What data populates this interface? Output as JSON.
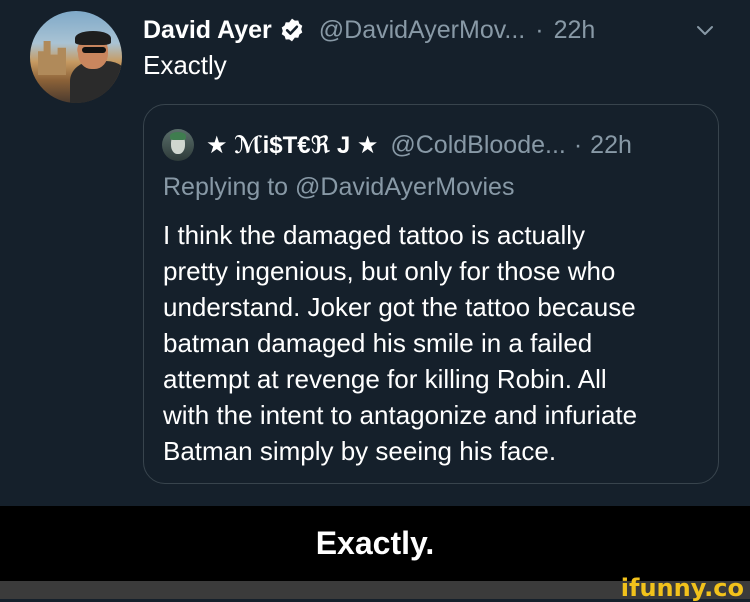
{
  "tweet": {
    "author_name": "David Ayer",
    "handle": "@DavidAyerMov...",
    "separator": "·",
    "time": "22h",
    "text": "Exactly",
    "icons": {
      "verified": "verified-badge-icon",
      "menu": "chevron-down-icon"
    }
  },
  "quoted_tweet": {
    "author_name": "★ ℳi$T€ℜ J ★",
    "handle": "@ColdBloode...",
    "separator": "·",
    "time": "22h",
    "replying_to": "Replying to @DavidAyerMovies",
    "text_lines": [
      "I think the damaged tattoo is actually",
      "pretty ingenious, but only for those who",
      "understand. Joker got the tattoo because",
      "batman damaged his smile in a failed",
      "attempt at revenge for killing Robin. All",
      "with the intent to antagonize and infuriate",
      "Batman simply by seeing his face."
    ]
  },
  "caption": "Exactly.",
  "watermark": "ifunny.co",
  "colors": {
    "background": "#15202b",
    "text_primary": "#ffffff",
    "text_secondary": "#8899a6",
    "verified_badge": "#ffffff",
    "caption_bar": "#000000",
    "watermark": "#f2c21b"
  }
}
